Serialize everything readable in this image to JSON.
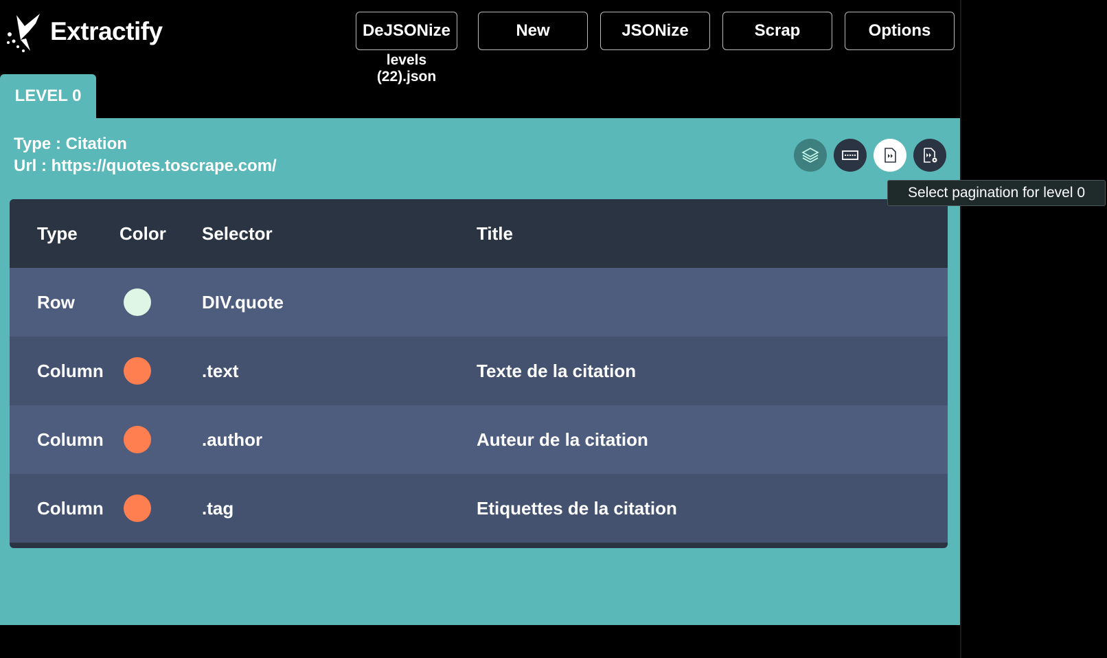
{
  "app": {
    "name": "Extractify"
  },
  "toolbar": {
    "dejsonize_label": "DeJSONize",
    "new_label": "New",
    "jsonize_label": "JSONize",
    "scrap_label": "Scrap",
    "options_label": "Options",
    "filename": "levels (22).json"
  },
  "tab": {
    "label": "LEVEL 0"
  },
  "level": {
    "type_label": "Type : ",
    "type_value": "Citation",
    "url_label": "Url : ",
    "url_value": "https://quotes.toscrape.com/"
  },
  "actions": {
    "layers_icon": "layers-icon",
    "row_icon": "row-select-icon",
    "pagination_icon": "pagination-icon",
    "pagination_settings_icon": "pagination-settings-icon"
  },
  "tooltip": "Select pagination for level 0",
  "table": {
    "headers": {
      "type": "Type",
      "color": "Color",
      "selector": "Selector",
      "title": "Title"
    },
    "rows": [
      {
        "type": "Row",
        "color": "#dff5e6",
        "selector": "DIV.quote",
        "title": ""
      },
      {
        "type": "Column",
        "color": "#ff7f50",
        "selector": ".text",
        "title": "Texte de la citation"
      },
      {
        "type": "Column",
        "color": "#ff7f50",
        "selector": ".author",
        "title": "Auteur de la citation"
      },
      {
        "type": "Column",
        "color": "#ff7f50",
        "selector": ".tag",
        "title": "Etiquettes de la citation"
      }
    ]
  },
  "colors": {
    "panel": "#5bb8b8",
    "header_bg": "#2b3442",
    "row_odd": "#4e5d7d",
    "row_even": "#44526f"
  }
}
